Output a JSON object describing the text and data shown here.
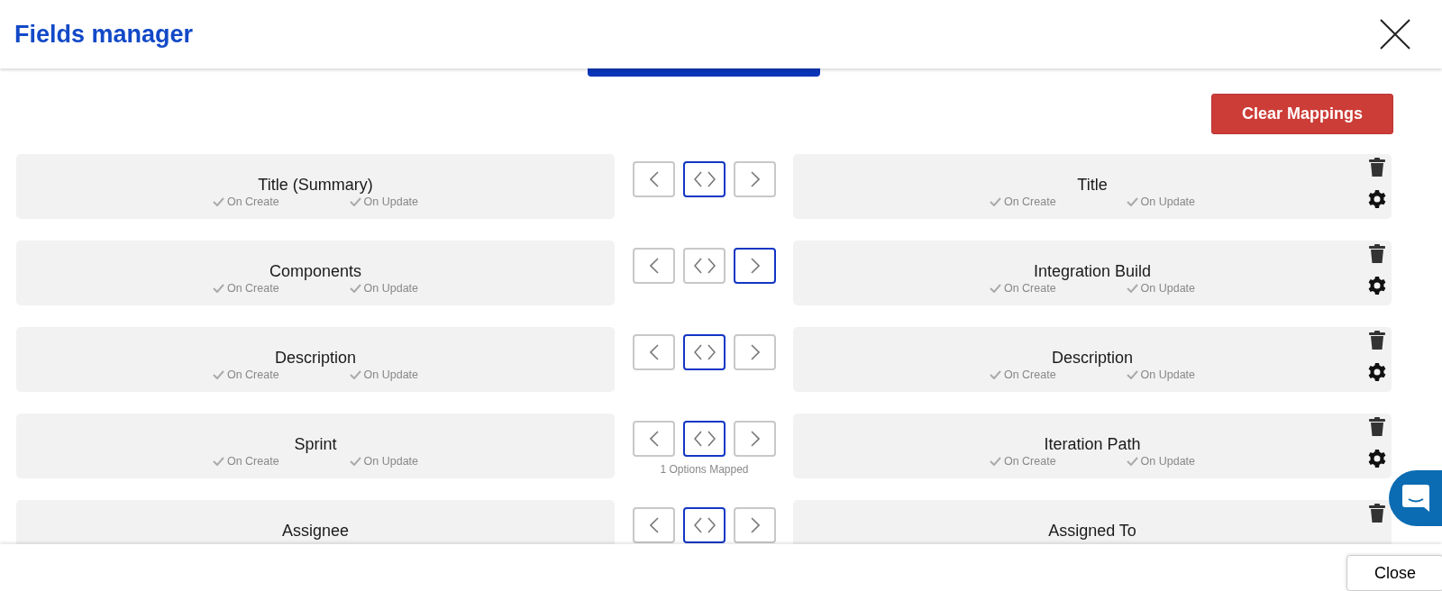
{
  "header": {
    "title": "Fields manager"
  },
  "toolbar": {
    "clear_label": "Clear Mappings"
  },
  "rows": [
    {
      "left": "Title (Summary)",
      "left_flags": [
        {
          "label": "On Create",
          "checked": true
        },
        {
          "label": "On Update",
          "checked": true
        }
      ],
      "sync_buttons": [
        {
          "kind": "left",
          "selected": false
        },
        {
          "kind": "both",
          "selected": true
        },
        {
          "kind": "right",
          "selected": false
        }
      ],
      "right": "Title",
      "right_flags": [
        {
          "label": "On Create",
          "checked": true
        },
        {
          "label": "On Update",
          "checked": true
        }
      ]
    },
    {
      "left": "Components",
      "left_flags": [
        {
          "label": "On Create",
          "checked": true
        },
        {
          "label": "On Update",
          "checked": true
        }
      ],
      "sync_buttons": [
        {
          "kind": "left",
          "selected": false
        },
        {
          "kind": "both",
          "selected": false
        },
        {
          "kind": "right",
          "selected": true
        }
      ],
      "right": "Integration Build",
      "right_flags": [
        {
          "label": "On Create",
          "checked": true
        },
        {
          "label": "On Update",
          "checked": true
        }
      ]
    },
    {
      "left": "Description",
      "left_flags": [
        {
          "label": "On Create",
          "checked": true
        },
        {
          "label": "On Update",
          "checked": true
        }
      ],
      "sync_buttons": [
        {
          "kind": "left",
          "selected": false
        },
        {
          "kind": "both",
          "selected": true
        },
        {
          "kind": "right",
          "selected": false
        }
      ],
      "right": "Description",
      "right_flags": [
        {
          "label": "On Create",
          "checked": true
        },
        {
          "label": "On Update",
          "checked": true
        }
      ]
    },
    {
      "left": "Sprint",
      "left_flags": [
        {
          "label": "On Create",
          "checked": true
        },
        {
          "label": "On Update",
          "checked": true
        }
      ],
      "sync_buttons": [
        {
          "kind": "left",
          "selected": false
        },
        {
          "kind": "both",
          "selected": true
        },
        {
          "kind": "right",
          "selected": false
        }
      ],
      "note": "1 Options Mapped",
      "right": "Iteration Path",
      "right_flags": [
        {
          "label": "On Create",
          "checked": true
        },
        {
          "label": "On Update",
          "checked": true
        }
      ]
    },
    {
      "left": "Assignee",
      "sync_buttons": [
        {
          "kind": "left",
          "selected": false
        },
        {
          "kind": "both",
          "selected": true
        },
        {
          "kind": "right",
          "selected": false
        }
      ],
      "right": "Assigned To"
    }
  ],
  "footer": {
    "close_button": "Close"
  }
}
